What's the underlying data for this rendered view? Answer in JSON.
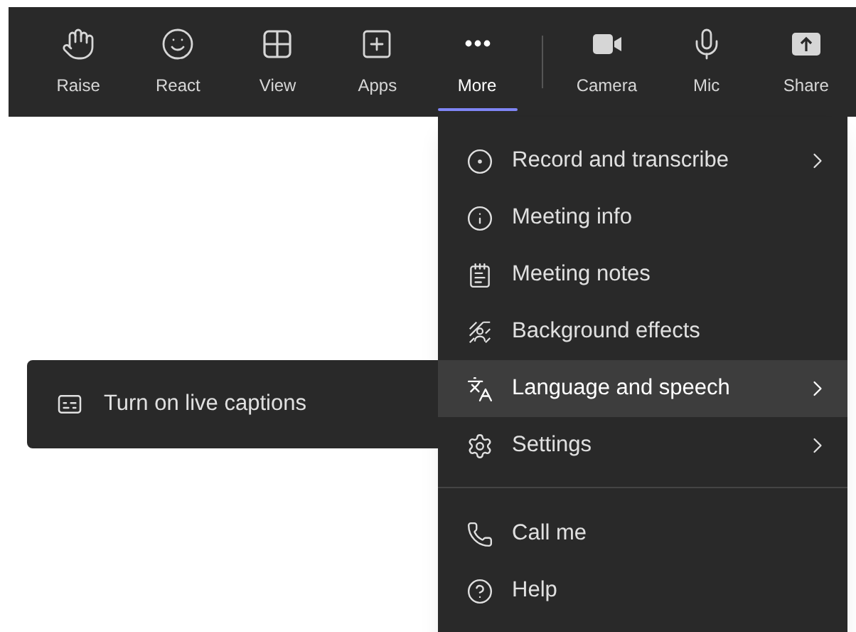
{
  "toolbar": {
    "groups": [
      [
        {
          "label": "Raise",
          "selected": false
        },
        {
          "label": "React",
          "selected": false
        },
        {
          "label": "View",
          "selected": false
        },
        {
          "label": "Apps",
          "selected": false
        },
        {
          "label": "More",
          "selected": true
        }
      ],
      [
        {
          "label": "Camera",
          "selected": false
        },
        {
          "label": "Mic",
          "selected": false
        },
        {
          "label": "Share",
          "selected": false
        }
      ]
    ]
  },
  "more_menu": {
    "sections": [
      [
        {
          "label": "Record and transcribe",
          "submenu": true,
          "selected": false
        },
        {
          "label": "Meeting info",
          "submenu": false,
          "selected": false
        },
        {
          "label": "Meeting notes",
          "submenu": false,
          "selected": false
        },
        {
          "label": "Background effects",
          "submenu": false,
          "selected": false
        },
        {
          "label": "Language and speech",
          "submenu": true,
          "selected": true
        },
        {
          "label": "Settings",
          "submenu": true,
          "selected": false
        }
      ],
      [
        {
          "label": "Call me",
          "submenu": false,
          "selected": false
        },
        {
          "label": "Help",
          "submenu": false,
          "selected": false
        }
      ]
    ]
  },
  "submenu": {
    "items": [
      {
        "label": "Turn on live captions"
      }
    ]
  }
}
